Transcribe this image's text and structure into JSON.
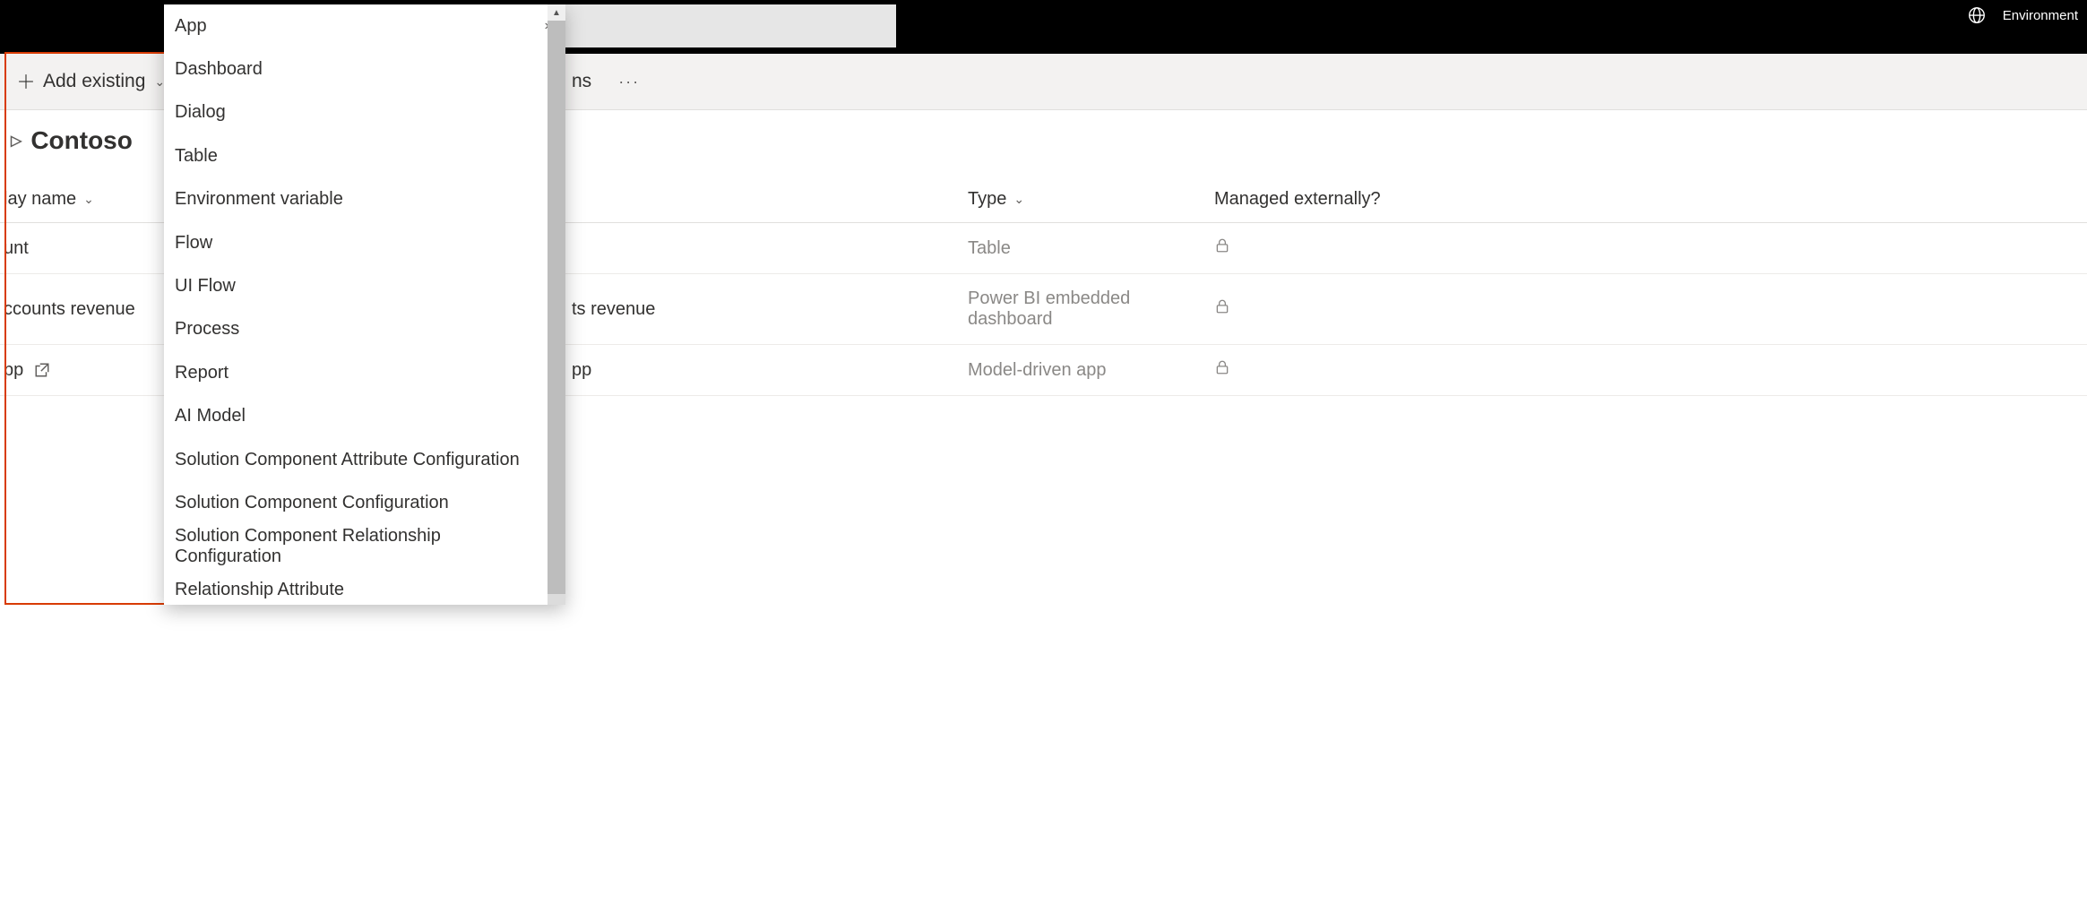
{
  "topbar": {
    "env_label": "Environment"
  },
  "commandbar": {
    "add_existing": "Add existing",
    "truncated_item": "ns",
    "more": "···"
  },
  "page": {
    "title": "Contoso"
  },
  "columns": {
    "name": "lay name",
    "type": "Type",
    "managed": "Managed externally?"
  },
  "rows": [
    {
      "name_fragment": "unt",
      "name_fragment2": "",
      "type": "Table",
      "locked": true,
      "open_icon": false
    },
    {
      "name_fragment": "ccounts revenue",
      "name_fragment2": "ts revenue",
      "type": "Power BI embedded dashboard",
      "locked": true,
      "open_icon": false
    },
    {
      "name_fragment": "pp",
      "name_fragment2": "pp",
      "type": "Model-driven app",
      "locked": true,
      "open_icon": true
    }
  ],
  "dropdown": {
    "items": [
      {
        "label": "App",
        "has_submenu": true
      },
      {
        "label": "Dashboard",
        "has_submenu": false
      },
      {
        "label": "Dialog",
        "has_submenu": false
      },
      {
        "label": "Table",
        "has_submenu": false
      },
      {
        "label": "Environment variable",
        "has_submenu": false
      },
      {
        "label": "Flow",
        "has_submenu": false
      },
      {
        "label": "UI Flow",
        "has_submenu": false
      },
      {
        "label": "Process",
        "has_submenu": false
      },
      {
        "label": "Report",
        "has_submenu": false
      },
      {
        "label": "AI Model",
        "has_submenu": false
      },
      {
        "label": "Solution Component Attribute Configuration",
        "has_submenu": false
      },
      {
        "label": "Solution Component Configuration",
        "has_submenu": false
      },
      {
        "label": "Solution Component Relationship Configuration",
        "has_submenu": false
      },
      {
        "label": "Relationship Attribute",
        "has_submenu": false
      }
    ]
  }
}
